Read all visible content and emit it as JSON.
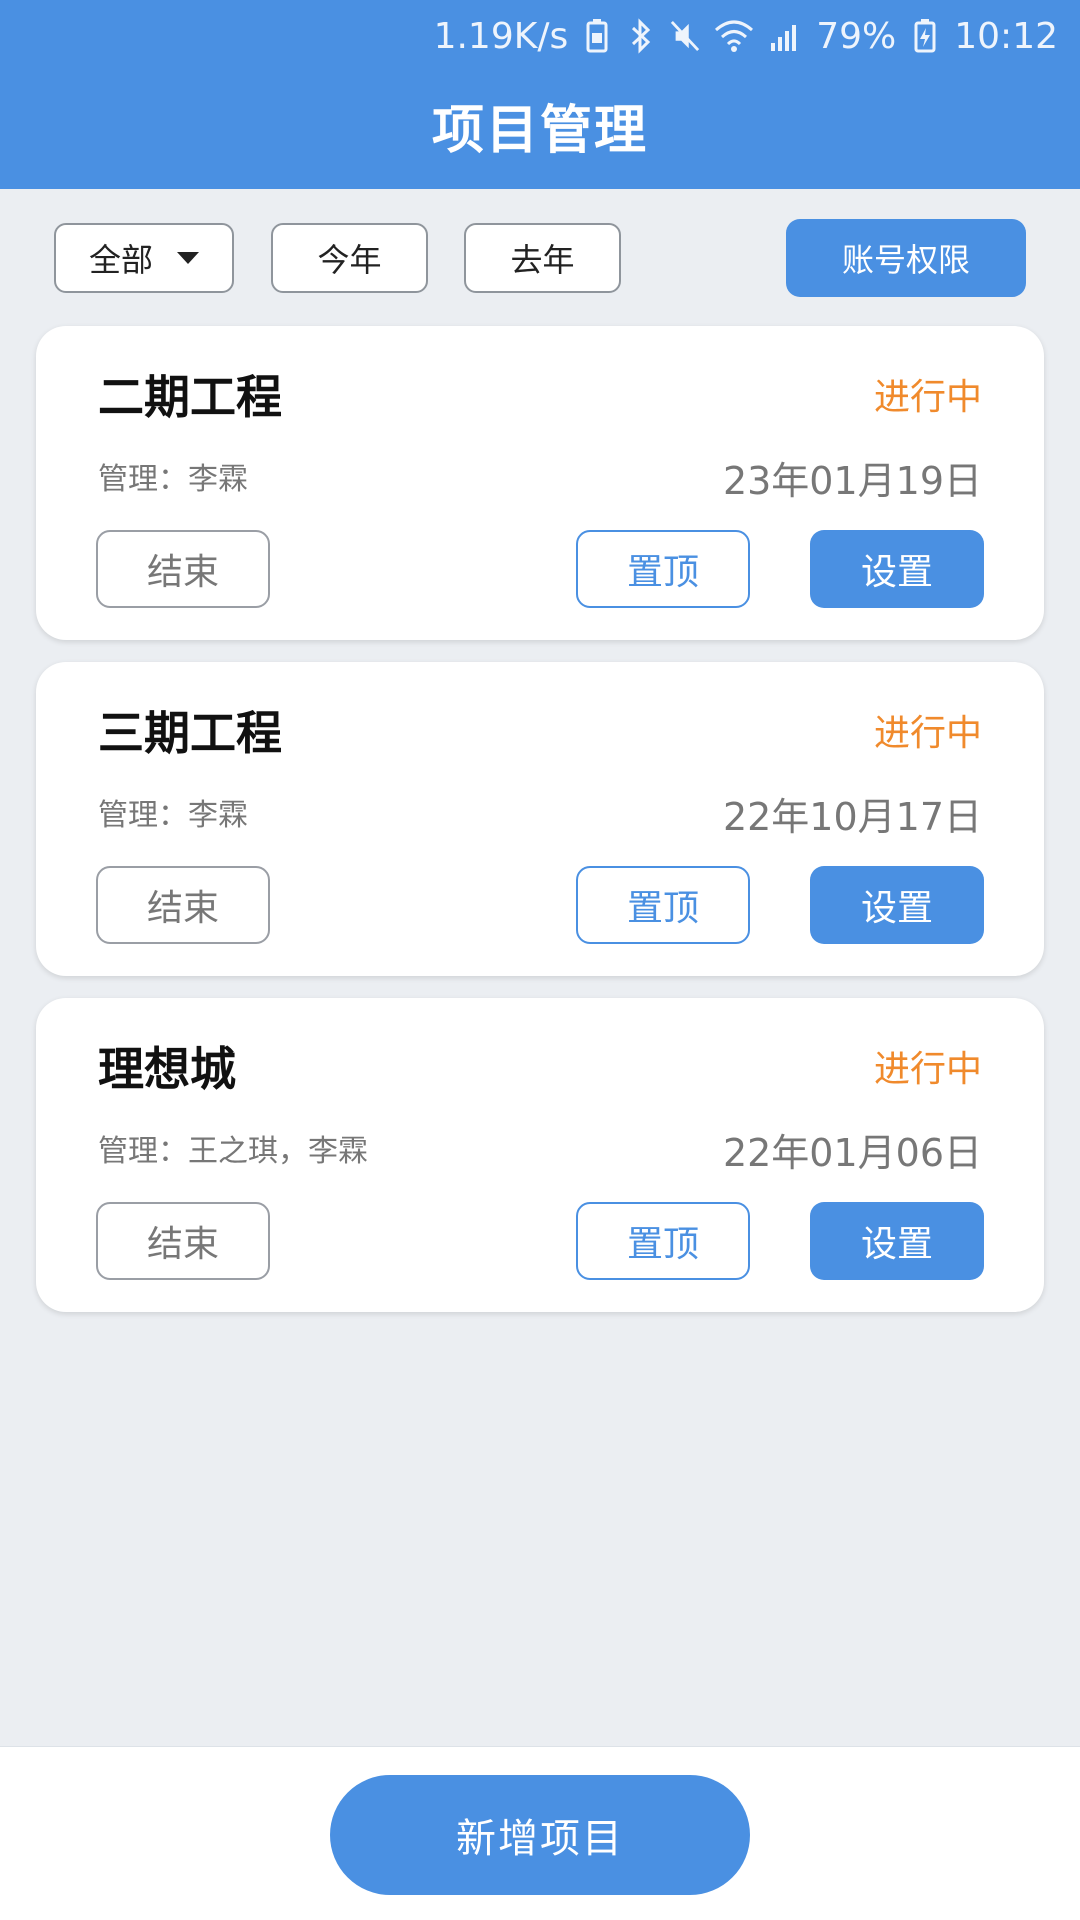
{
  "status_bar": {
    "speed": "1.19K/s",
    "battery_percent": "79%",
    "time": "10:12",
    "icons": [
      "battery-saver-icon",
      "bluetooth-icon",
      "mute-icon",
      "wifi-icon",
      "signal-icon",
      "battery-charging-icon"
    ]
  },
  "header": {
    "title": "项目管理"
  },
  "filters": {
    "all_label": "全部",
    "this_year_label": "今年",
    "last_year_label": "去年",
    "permissions_label": "账号权限"
  },
  "projects": [
    {
      "name": "二期工程",
      "status": "进行中",
      "manager": "管理：李霖",
      "date": "23年01月19日",
      "end_label": "结束",
      "pin_label": "置顶",
      "settings_label": "设置"
    },
    {
      "name": "三期工程",
      "status": "进行中",
      "manager": "管理：李霖",
      "date": "22年10月17日",
      "end_label": "结束",
      "pin_label": "置顶",
      "settings_label": "设置"
    },
    {
      "name": "理想城",
      "status": "进行中",
      "manager": "管理：王之琪，李霖",
      "date": "22年01月06日",
      "end_label": "结束",
      "pin_label": "置顶",
      "settings_label": "设置"
    }
  ],
  "footer": {
    "add_label": "新增项目"
  },
  "colors": {
    "primary": "#4a90e2",
    "status_in_progress": "#f08a2c",
    "background": "#ebeef2"
  }
}
